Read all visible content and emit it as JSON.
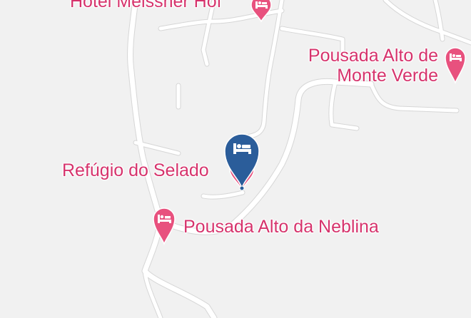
{
  "map": {
    "colors": {
      "background": "#f1f1f1",
      "road": "#ffffff",
      "road_casing": "#d6d6d6",
      "poi_label": "#d6336c",
      "poi_pin": "#e8517e",
      "selected_pin": "#2b5d9a"
    },
    "places": [
      {
        "name": "Hotel Meissner Hof",
        "icon": "hotel-bed-icon"
      },
      {
        "name_line1": "Pousada Alto de",
        "name_line2": "Monte Verde",
        "icon": "hotel-bed-icon"
      },
      {
        "name": "Refúgio do Selado",
        "icon": "hotel-bed-icon",
        "selected": true
      },
      {
        "name": "Pousada Alto da Neblina",
        "icon": "hotel-bed-icon"
      }
    ],
    "selected_marker": {
      "icon": "hotel-bed-icon",
      "color": "#2b5d9a"
    }
  }
}
